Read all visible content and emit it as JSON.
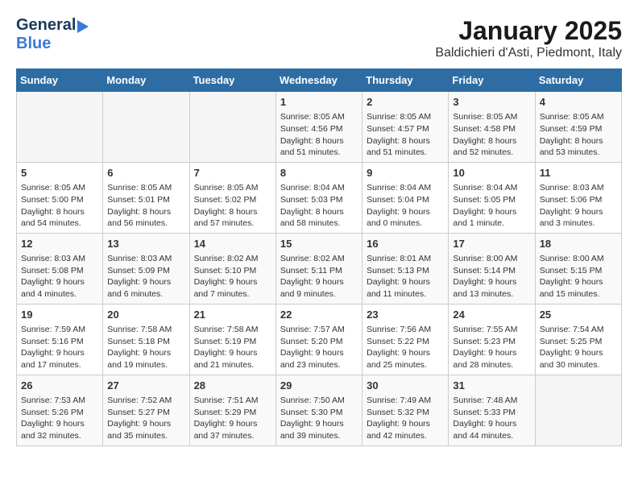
{
  "logo": {
    "general": "General",
    "blue": "Blue"
  },
  "title": "January 2025",
  "subtitle": "Baldichieri d'Asti, Piedmont, Italy",
  "days_of_week": [
    "Sunday",
    "Monday",
    "Tuesday",
    "Wednesday",
    "Thursday",
    "Friday",
    "Saturday"
  ],
  "weeks": [
    [
      {
        "day": "",
        "content": ""
      },
      {
        "day": "",
        "content": ""
      },
      {
        "day": "",
        "content": ""
      },
      {
        "day": "1",
        "content": "Sunrise: 8:05 AM\nSunset: 4:56 PM\nDaylight: 8 hours and 51 minutes."
      },
      {
        "day": "2",
        "content": "Sunrise: 8:05 AM\nSunset: 4:57 PM\nDaylight: 8 hours and 51 minutes."
      },
      {
        "day": "3",
        "content": "Sunrise: 8:05 AM\nSunset: 4:58 PM\nDaylight: 8 hours and 52 minutes."
      },
      {
        "day": "4",
        "content": "Sunrise: 8:05 AM\nSunset: 4:59 PM\nDaylight: 8 hours and 53 minutes."
      }
    ],
    [
      {
        "day": "5",
        "content": "Sunrise: 8:05 AM\nSunset: 5:00 PM\nDaylight: 8 hours and 54 minutes."
      },
      {
        "day": "6",
        "content": "Sunrise: 8:05 AM\nSunset: 5:01 PM\nDaylight: 8 hours and 56 minutes."
      },
      {
        "day": "7",
        "content": "Sunrise: 8:05 AM\nSunset: 5:02 PM\nDaylight: 8 hours and 57 minutes."
      },
      {
        "day": "8",
        "content": "Sunrise: 8:04 AM\nSunset: 5:03 PM\nDaylight: 8 hours and 58 minutes."
      },
      {
        "day": "9",
        "content": "Sunrise: 8:04 AM\nSunset: 5:04 PM\nDaylight: 9 hours and 0 minutes."
      },
      {
        "day": "10",
        "content": "Sunrise: 8:04 AM\nSunset: 5:05 PM\nDaylight: 9 hours and 1 minute."
      },
      {
        "day": "11",
        "content": "Sunrise: 8:03 AM\nSunset: 5:06 PM\nDaylight: 9 hours and 3 minutes."
      }
    ],
    [
      {
        "day": "12",
        "content": "Sunrise: 8:03 AM\nSunset: 5:08 PM\nDaylight: 9 hours and 4 minutes."
      },
      {
        "day": "13",
        "content": "Sunrise: 8:03 AM\nSunset: 5:09 PM\nDaylight: 9 hours and 6 minutes."
      },
      {
        "day": "14",
        "content": "Sunrise: 8:02 AM\nSunset: 5:10 PM\nDaylight: 9 hours and 7 minutes."
      },
      {
        "day": "15",
        "content": "Sunrise: 8:02 AM\nSunset: 5:11 PM\nDaylight: 9 hours and 9 minutes."
      },
      {
        "day": "16",
        "content": "Sunrise: 8:01 AM\nSunset: 5:13 PM\nDaylight: 9 hours and 11 minutes."
      },
      {
        "day": "17",
        "content": "Sunrise: 8:00 AM\nSunset: 5:14 PM\nDaylight: 9 hours and 13 minutes."
      },
      {
        "day": "18",
        "content": "Sunrise: 8:00 AM\nSunset: 5:15 PM\nDaylight: 9 hours and 15 minutes."
      }
    ],
    [
      {
        "day": "19",
        "content": "Sunrise: 7:59 AM\nSunset: 5:16 PM\nDaylight: 9 hours and 17 minutes."
      },
      {
        "day": "20",
        "content": "Sunrise: 7:58 AM\nSunset: 5:18 PM\nDaylight: 9 hours and 19 minutes."
      },
      {
        "day": "21",
        "content": "Sunrise: 7:58 AM\nSunset: 5:19 PM\nDaylight: 9 hours and 21 minutes."
      },
      {
        "day": "22",
        "content": "Sunrise: 7:57 AM\nSunset: 5:20 PM\nDaylight: 9 hours and 23 minutes."
      },
      {
        "day": "23",
        "content": "Sunrise: 7:56 AM\nSunset: 5:22 PM\nDaylight: 9 hours and 25 minutes."
      },
      {
        "day": "24",
        "content": "Sunrise: 7:55 AM\nSunset: 5:23 PM\nDaylight: 9 hours and 28 minutes."
      },
      {
        "day": "25",
        "content": "Sunrise: 7:54 AM\nSunset: 5:25 PM\nDaylight: 9 hours and 30 minutes."
      }
    ],
    [
      {
        "day": "26",
        "content": "Sunrise: 7:53 AM\nSunset: 5:26 PM\nDaylight: 9 hours and 32 minutes."
      },
      {
        "day": "27",
        "content": "Sunrise: 7:52 AM\nSunset: 5:27 PM\nDaylight: 9 hours and 35 minutes."
      },
      {
        "day": "28",
        "content": "Sunrise: 7:51 AM\nSunset: 5:29 PM\nDaylight: 9 hours and 37 minutes."
      },
      {
        "day": "29",
        "content": "Sunrise: 7:50 AM\nSunset: 5:30 PM\nDaylight: 9 hours and 39 minutes."
      },
      {
        "day": "30",
        "content": "Sunrise: 7:49 AM\nSunset: 5:32 PM\nDaylight: 9 hours and 42 minutes."
      },
      {
        "day": "31",
        "content": "Sunrise: 7:48 AM\nSunset: 5:33 PM\nDaylight: 9 hours and 44 minutes."
      },
      {
        "day": "",
        "content": ""
      }
    ]
  ]
}
